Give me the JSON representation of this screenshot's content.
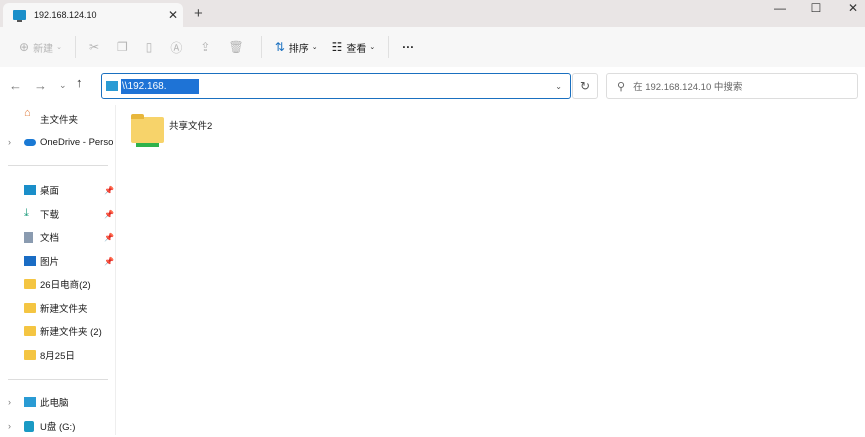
{
  "tab": {
    "title": "192.168.124.10",
    "close": "✕",
    "new_tab": "+"
  },
  "window": {
    "minimize": "—",
    "maximize": "☐",
    "close": "✕"
  },
  "toolbar": {
    "new_label": "新建",
    "sort_label": "排序",
    "view_label": "查看",
    "more": "···"
  },
  "address": {
    "value": "\\\\192.168.",
    "search_placeholder": "在 192.168.124.10 中搜索"
  },
  "sidebar": {
    "items": [
      {
        "label": "主文件夹",
        "icon": "home-icon"
      },
      {
        "label": "OneDrive - Perso",
        "icon": "cloud-icon"
      },
      {
        "label": "桌面",
        "icon": "desktop-icon",
        "pinned": true
      },
      {
        "label": "下载",
        "icon": "download-icon",
        "pinned": true
      },
      {
        "label": "文档",
        "icon": "document-icon",
        "pinned": true
      },
      {
        "label": "图片",
        "icon": "pictures-icon",
        "pinned": true
      },
      {
        "label": "26日电商(2)",
        "icon": "folder-icon"
      },
      {
        "label": "新建文件夹",
        "icon": "folder-icon"
      },
      {
        "label": "新建文件夹 (2)",
        "icon": "folder-icon"
      },
      {
        "label": "8月25日",
        "icon": "folder-icon"
      },
      {
        "label": "此电脑",
        "icon": "computer-icon"
      },
      {
        "label": "U盘 (G:)",
        "icon": "usb-drive-icon"
      }
    ]
  },
  "files": [
    {
      "name": "共享文件2"
    }
  ],
  "colors": {
    "accent": "#1a70c0",
    "selection": "#1e73d6"
  }
}
